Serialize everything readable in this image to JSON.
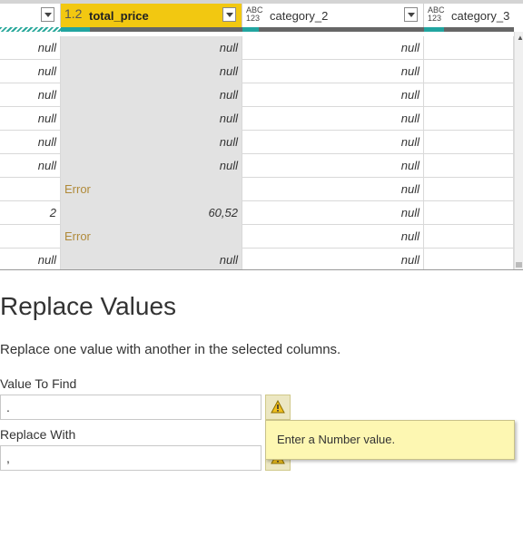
{
  "columns": [
    {
      "name": "",
      "type": ""
    },
    {
      "name": "total_price",
      "type": "1.2"
    },
    {
      "name": "category_2",
      "type_top": "ABC",
      "type_bottom": "123"
    },
    {
      "name": "category_3",
      "type_top": "ABC",
      "type_bottom": "123"
    }
  ],
  "rows": [
    [
      "null",
      "null",
      "null",
      ""
    ],
    [
      "null",
      "null",
      "null",
      ""
    ],
    [
      "null",
      "null",
      "null",
      ""
    ],
    [
      "null",
      "null",
      "null",
      ""
    ],
    [
      "null",
      "null",
      "null",
      ""
    ],
    [
      "null",
      "null",
      "null",
      ""
    ],
    [
      "",
      "Error",
      "null",
      ""
    ],
    [
      "2",
      "60,52",
      "null",
      ""
    ],
    [
      "",
      "Error",
      "null",
      ""
    ],
    [
      "null",
      "null",
      "null",
      ""
    ]
  ],
  "dialog": {
    "title": "Replace Values",
    "description": "Replace one value with another in the selected columns.",
    "find_label": "Value To Find",
    "find_value": ".",
    "replace_label": "Replace With",
    "replace_value": ",",
    "tooltip": "Enter a Number value."
  },
  "colors": {
    "selected_header": "#f2c811",
    "error_text": "#b08a3a",
    "quality_bar": "#21a5a0",
    "tooltip_bg": "#fdf7b2"
  },
  "icons": [
    "chevron-down-icon",
    "warning-icon",
    "scroll-up-arrow-icon"
  ]
}
